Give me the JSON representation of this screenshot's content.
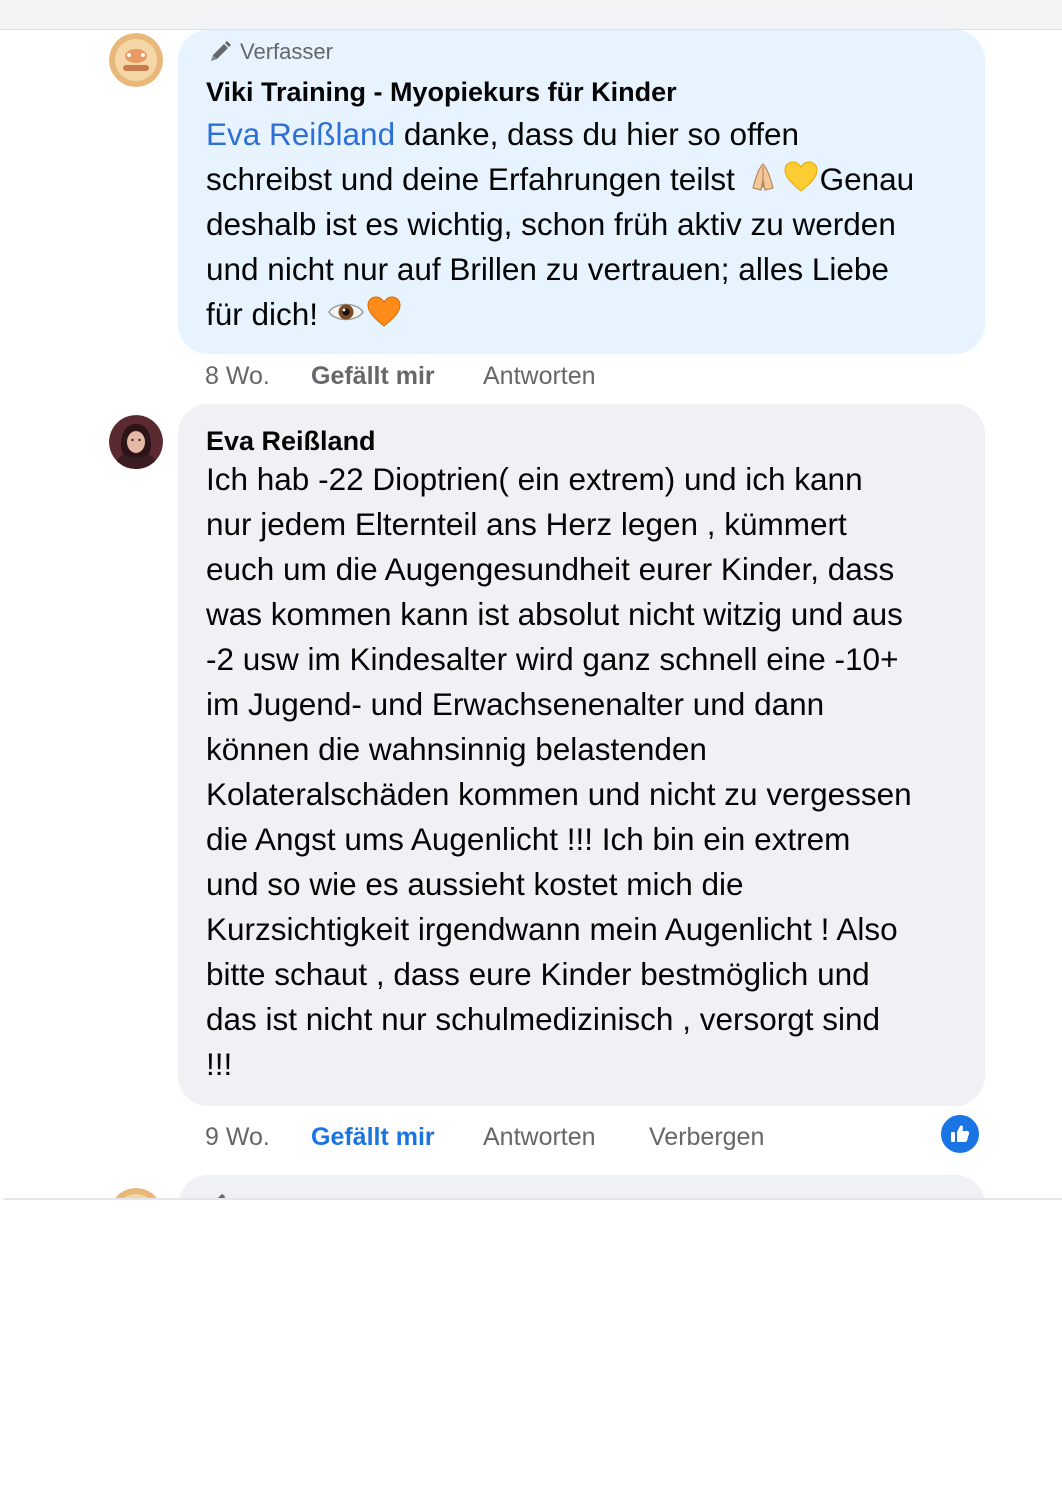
{
  "comments": [
    {
      "badge": "Verfasser",
      "author": "Viki Training - Myopiekurs für Kinder",
      "mention": "Eva Reißland",
      "lines": [
        " danke, dass du hier so offen",
        "schreibst und deine Erfahrungen teilst ",
        "Genau",
        "deshalb ist es wichtig, schon früh aktiv zu werden",
        "und nicht nur auf Brillen zu vertrauen; alles Liebe",
        "für dich! "
      ],
      "emojis": [
        "folded-hands-emoji",
        "yellow-heart-emoji",
        "eye-emoji",
        "orange-heart-emoji"
      ],
      "time": "8 Wo.",
      "like_label": "Gefällt mir",
      "reply_label": "Antworten",
      "liked": false
    },
    {
      "author": "Eva Reißland",
      "lines": [
        "Ich hab -22 Dioptrien( ein extrem) und ich kann",
        "nur jedem Elternteil ans Herz legen , kümmert",
        "euch um die Augengesundheit eurer Kinder, dass",
        "was kommen kann ist absolut nicht witzig und aus",
        "-2 usw im Kindesalter wird ganz schnell eine -10+",
        "im Jugend- und Erwachsenenalter und dann",
        "können die wahnsinnig belastenden",
        "Kolateralschäden kommen und nicht zu vergessen",
        "die Angst ums Augenlicht !!! Ich bin ein extrem",
        "und so wie es aussieht kostet mich die",
        "Kurzsichtigkeit irgendwann mein Augenlicht ! Also",
        "bitte schaut , dass eure Kinder bestmöglich und",
        "das ist nicht nur schulmedizinisch , versorgt sind",
        "!!!"
      ],
      "time": "9 Wo.",
      "like_label": "Gefällt mir",
      "reply_label": "Antworten",
      "hide_label": "Verbergen",
      "liked": true,
      "reaction_icon": "thumbs-up-icon"
    }
  ],
  "colors": {
    "author_bubble": "#e7f3ff",
    "user_bubble": "#eff1f4",
    "mention": "#2d6fd6",
    "like_active": "#1b74e4",
    "meta_text": "#65676b"
  }
}
